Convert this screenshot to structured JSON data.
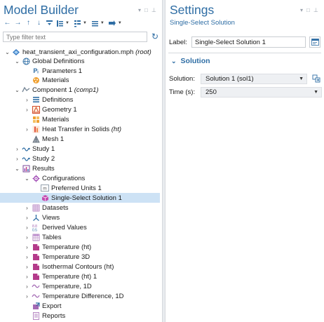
{
  "model_builder": {
    "title": "Model Builder",
    "filter_placeholder": "Type filter text",
    "tree": [
      {
        "id": "root",
        "label": "heat_transient_axi_configuration.mph",
        "tag": "(root)",
        "icon": "model-file-icon"
      },
      {
        "id": "global-definitions",
        "label": "Global Definitions",
        "icon": "globe-icon"
      },
      {
        "id": "parameters",
        "label": "Parameters 1",
        "icon": "parameters-icon"
      },
      {
        "id": "materials-global",
        "label": "Materials",
        "icon": "materials-icon"
      },
      {
        "id": "component",
        "label": "Component 1",
        "tag": "(comp1)",
        "icon": "component-icon"
      },
      {
        "id": "definitions",
        "label": "Definitions",
        "icon": "definitions-icon"
      },
      {
        "id": "geometry",
        "label": "Geometry 1",
        "icon": "geometry-icon"
      },
      {
        "id": "materials-comp",
        "label": "Materials",
        "icon": "materials-icon"
      },
      {
        "id": "heat-transfer",
        "label": "Heat Transfer in Solids",
        "tag": "(ht)",
        "icon": "heat-transfer-icon"
      },
      {
        "id": "mesh",
        "label": "Mesh 1",
        "icon": "mesh-icon"
      },
      {
        "id": "study1",
        "label": "Study 1",
        "icon": "study-icon"
      },
      {
        "id": "study2",
        "label": "Study 2",
        "icon": "study-icon"
      },
      {
        "id": "results",
        "label": "Results",
        "icon": "results-icon"
      },
      {
        "id": "configurations",
        "label": "Configurations",
        "icon": "configurations-icon"
      },
      {
        "id": "preferred-units",
        "label": "Preferred Units 1",
        "icon": "units-icon"
      },
      {
        "id": "single-select",
        "label": "Single-Select Solution 1",
        "icon": "solution-icon"
      },
      {
        "id": "datasets",
        "label": "Datasets",
        "icon": "datasets-icon"
      },
      {
        "id": "views",
        "label": "Views",
        "icon": "views-icon"
      },
      {
        "id": "derived-values",
        "label": "Derived Values",
        "icon": "derived-values-icon"
      },
      {
        "id": "tables",
        "label": "Tables",
        "icon": "tables-icon"
      },
      {
        "id": "temp-ht",
        "label": "Temperature (ht)",
        "icon": "plot-group-icon"
      },
      {
        "id": "temp-3d",
        "label": "Temperature 3D",
        "icon": "plot-group-icon"
      },
      {
        "id": "isothermal",
        "label": "Isothermal Contours (ht)",
        "icon": "plot-group-icon"
      },
      {
        "id": "temp-ht-1",
        "label": "Temperature (ht) 1",
        "icon": "plot-group-icon"
      },
      {
        "id": "temp-1d",
        "label": "Temperature, 1D",
        "icon": "line-plot-icon"
      },
      {
        "id": "temp-diff-1d",
        "label": "Temperature Difference, 1D",
        "icon": "line-plot-icon"
      },
      {
        "id": "export",
        "label": "Export",
        "icon": "export-icon"
      },
      {
        "id": "reports",
        "label": "Reports",
        "icon": "reports-icon"
      }
    ]
  },
  "settings": {
    "title": "Settings",
    "subtitle": "Single-Select Solution",
    "label_caption": "Label:",
    "label_value": "Single-Select Solution 1",
    "section_title": "Solution",
    "solution_caption": "Solution:",
    "solution_value": "Solution 1 (sol1)",
    "time_caption": "Time (s):",
    "time_value": "250"
  },
  "colors": {
    "accent": "#2e6da4",
    "selection": "#cde2f5"
  }
}
